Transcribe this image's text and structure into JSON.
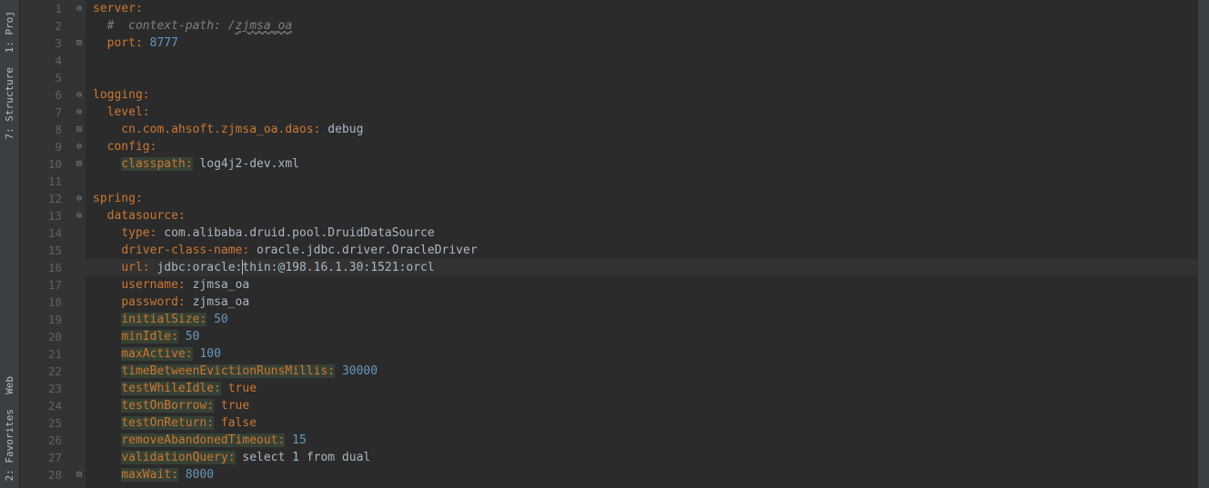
{
  "sidebar": {
    "tabs": [
      {
        "label": "1: Proj",
        "icon": "📁"
      },
      {
        "label": "7: Structure",
        "icon": "⊞"
      },
      {
        "label": "Web",
        "icon": "🌐"
      },
      {
        "label": "2: Favorites",
        "icon": "★"
      }
    ]
  },
  "editor": {
    "currentLine": 16,
    "lines": [
      {
        "num": 1,
        "fold": "⊖",
        "segs": [
          {
            "t": "server:",
            "c": "key"
          }
        ]
      },
      {
        "num": 2,
        "fold": "",
        "segs": [
          {
            "t": "  ",
            "c": ""
          },
          {
            "t": "#  context-path: /",
            "c": "comment"
          },
          {
            "t": "zjmsa_oa",
            "c": "comment squiggle"
          }
        ]
      },
      {
        "num": 3,
        "fold": "⊟",
        "segs": [
          {
            "t": "  ",
            "c": ""
          },
          {
            "t": "port:",
            "c": "key"
          },
          {
            "t": " ",
            "c": ""
          },
          {
            "t": "8777",
            "c": "number"
          }
        ]
      },
      {
        "num": 4,
        "fold": "",
        "segs": []
      },
      {
        "num": 5,
        "fold": "",
        "segs": []
      },
      {
        "num": 6,
        "fold": "⊖",
        "segs": [
          {
            "t": "logging:",
            "c": "key"
          }
        ]
      },
      {
        "num": 7,
        "fold": "⊖",
        "segs": [
          {
            "t": "  ",
            "c": ""
          },
          {
            "t": "level:",
            "c": "key"
          }
        ]
      },
      {
        "num": 8,
        "fold": "⊟",
        "segs": [
          {
            "t": "    ",
            "c": ""
          },
          {
            "t": "cn.com.ahsoft.zjmsa_oa.daos:",
            "c": "key"
          },
          {
            "t": " debug",
            "c": "value"
          }
        ]
      },
      {
        "num": 9,
        "fold": "⊖",
        "segs": [
          {
            "t": "  ",
            "c": ""
          },
          {
            "t": "config:",
            "c": "key"
          }
        ]
      },
      {
        "num": 10,
        "fold": "⊟",
        "segs": [
          {
            "t": "    ",
            "c": ""
          },
          {
            "t": "classpath:",
            "c": "key-hl"
          },
          {
            "t": " log4j2-dev.xml",
            "c": "value"
          }
        ]
      },
      {
        "num": 11,
        "fold": "",
        "segs": []
      },
      {
        "num": 12,
        "fold": "⊖",
        "segs": [
          {
            "t": "spring:",
            "c": "key"
          }
        ]
      },
      {
        "num": 13,
        "fold": "⊖",
        "segs": [
          {
            "t": "  ",
            "c": ""
          },
          {
            "t": "datasource:",
            "c": "key"
          }
        ]
      },
      {
        "num": 14,
        "fold": "",
        "segs": [
          {
            "t": "    ",
            "c": ""
          },
          {
            "t": "type:",
            "c": "key"
          },
          {
            "t": " com.alibaba.druid.pool.DruidDataSource",
            "c": "value"
          }
        ]
      },
      {
        "num": 15,
        "fold": "",
        "segs": [
          {
            "t": "    ",
            "c": ""
          },
          {
            "t": "driver-class-name:",
            "c": "key"
          },
          {
            "t": " oracle.jdbc.driver.OracleDriver",
            "c": "value"
          }
        ]
      },
      {
        "num": 16,
        "fold": "",
        "current": true,
        "segs": [
          {
            "t": "    ",
            "c": ""
          },
          {
            "t": "url:",
            "c": "key"
          },
          {
            "t": " jdbc:oracle:thin:@198.16.1.30:1521:orcl",
            "c": "value"
          }
        ]
      },
      {
        "num": 17,
        "fold": "",
        "segs": [
          {
            "t": "    ",
            "c": ""
          },
          {
            "t": "username:",
            "c": "key"
          },
          {
            "t": " zjmsa_oa",
            "c": "value"
          }
        ]
      },
      {
        "num": 18,
        "fold": "",
        "segs": [
          {
            "t": "    ",
            "c": ""
          },
          {
            "t": "password:",
            "c": "key"
          },
          {
            "t": " zjmsa_oa",
            "c": "value"
          }
        ]
      },
      {
        "num": 19,
        "fold": "",
        "segs": [
          {
            "t": "    ",
            "c": ""
          },
          {
            "t": "initialSize:",
            "c": "key-hl"
          },
          {
            "t": " ",
            "c": ""
          },
          {
            "t": "50",
            "c": "number"
          }
        ]
      },
      {
        "num": 20,
        "fold": "",
        "segs": [
          {
            "t": "    ",
            "c": ""
          },
          {
            "t": "minIdle:",
            "c": "key-hl"
          },
          {
            "t": " ",
            "c": ""
          },
          {
            "t": "50",
            "c": "number"
          }
        ]
      },
      {
        "num": 21,
        "fold": "",
        "segs": [
          {
            "t": "    ",
            "c": ""
          },
          {
            "t": "maxActive:",
            "c": "key-hl"
          },
          {
            "t": " ",
            "c": ""
          },
          {
            "t": "100",
            "c": "number"
          }
        ]
      },
      {
        "num": 22,
        "fold": "",
        "segs": [
          {
            "t": "    ",
            "c": ""
          },
          {
            "t": "timeBetweenEvictionRunsMillis:",
            "c": "key-hl"
          },
          {
            "t": " ",
            "c": ""
          },
          {
            "t": "30000",
            "c": "number"
          }
        ]
      },
      {
        "num": 23,
        "fold": "",
        "segs": [
          {
            "t": "    ",
            "c": ""
          },
          {
            "t": "testWhileIdle:",
            "c": "key-hl"
          },
          {
            "t": " ",
            "c": ""
          },
          {
            "t": "true",
            "c": "bool"
          }
        ]
      },
      {
        "num": 24,
        "fold": "",
        "segs": [
          {
            "t": "    ",
            "c": ""
          },
          {
            "t": "testOnBorrow:",
            "c": "key-hl"
          },
          {
            "t": " ",
            "c": ""
          },
          {
            "t": "true",
            "c": "bool"
          }
        ]
      },
      {
        "num": 25,
        "fold": "",
        "segs": [
          {
            "t": "    ",
            "c": ""
          },
          {
            "t": "testOnReturn:",
            "c": "key-hl"
          },
          {
            "t": " ",
            "c": ""
          },
          {
            "t": "false",
            "c": "bool"
          }
        ]
      },
      {
        "num": 26,
        "fold": "",
        "segs": [
          {
            "t": "    ",
            "c": ""
          },
          {
            "t": "removeAbandonedTimeout:",
            "c": "key-hl"
          },
          {
            "t": " ",
            "c": ""
          },
          {
            "t": "15",
            "c": "number"
          }
        ]
      },
      {
        "num": 27,
        "fold": "",
        "segs": [
          {
            "t": "    ",
            "c": ""
          },
          {
            "t": "validationQuery:",
            "c": "key-hl"
          },
          {
            "t": " select 1 from dual",
            "c": "value"
          }
        ]
      },
      {
        "num": 28,
        "fold": "⊟",
        "segs": [
          {
            "t": "    ",
            "c": ""
          },
          {
            "t": "maxWait:",
            "c": "key-hl"
          },
          {
            "t": " ",
            "c": ""
          },
          {
            "t": "8000",
            "c": "number"
          }
        ]
      }
    ]
  }
}
